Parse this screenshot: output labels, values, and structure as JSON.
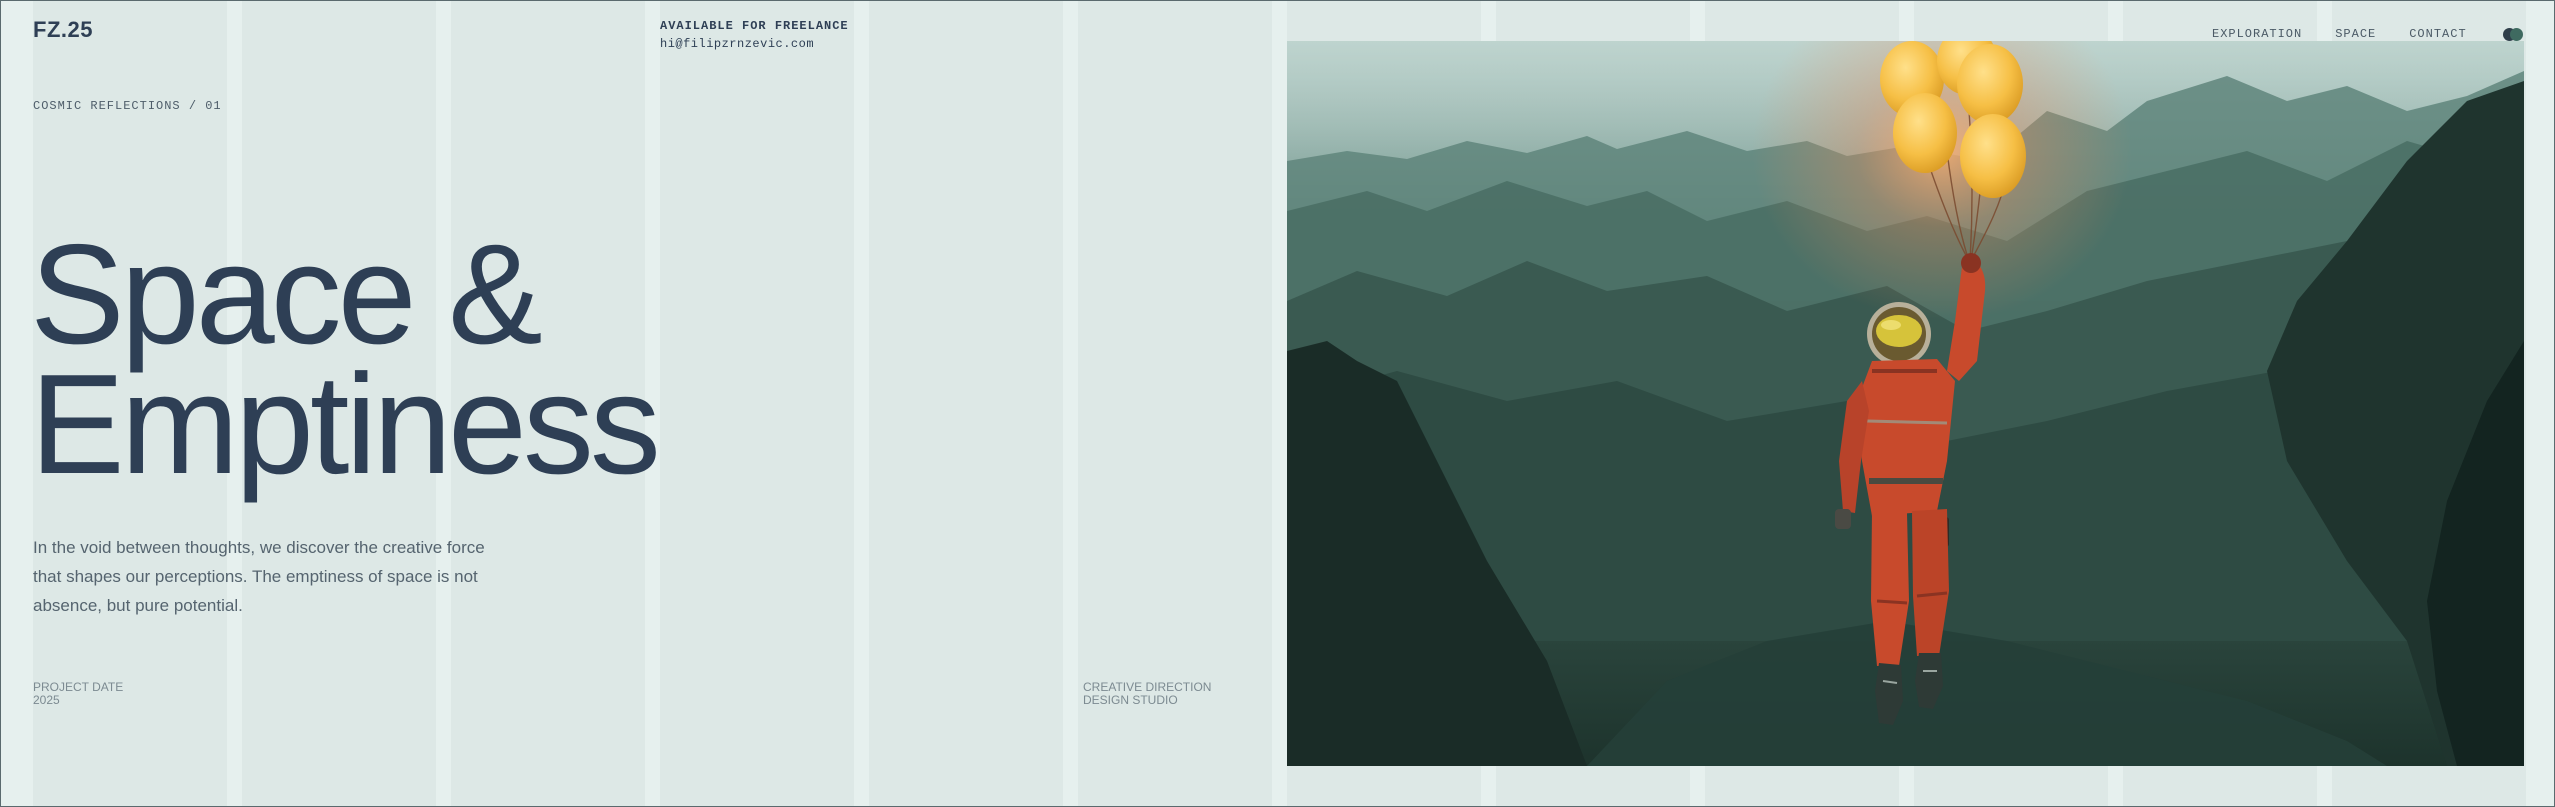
{
  "header": {
    "logo": "FZ.25",
    "availability": "AVAILABLE FOR FREELANCE",
    "email": "hi@filipzrnzevic.com",
    "nav": {
      "items": [
        {
          "label": "EXPLORATION"
        },
        {
          "label": "SPACE"
        },
        {
          "label": "CONTACT"
        }
      ]
    }
  },
  "hero": {
    "eyebrow": "COSMIC REFLECTIONS / 01",
    "title_line1": "Space &",
    "title_line2": "Emptiness",
    "intro_line1": "In the void between thoughts, we discover the creative force",
    "intro_line2": "that shapes our perceptions. The emptiness of space is not",
    "intro_line3": "absence, but pure potential.",
    "image": {
      "subject": "astronaut-with-balloons",
      "scene": "misty green canyon"
    }
  },
  "meta": {
    "project_date_label": "PROJECT DATE",
    "project_date_value": "2025",
    "discipline_line1": "CREATIVE DIRECTION",
    "discipline_line2": "DESIGN STUDIO"
  },
  "colors": {
    "background": "#e6f0ee",
    "column": "#dde8e6",
    "ink": "#2e3f55",
    "muted": "#7c8a91",
    "balloon": "#f8c44c",
    "suit": "#c84a2c"
  }
}
